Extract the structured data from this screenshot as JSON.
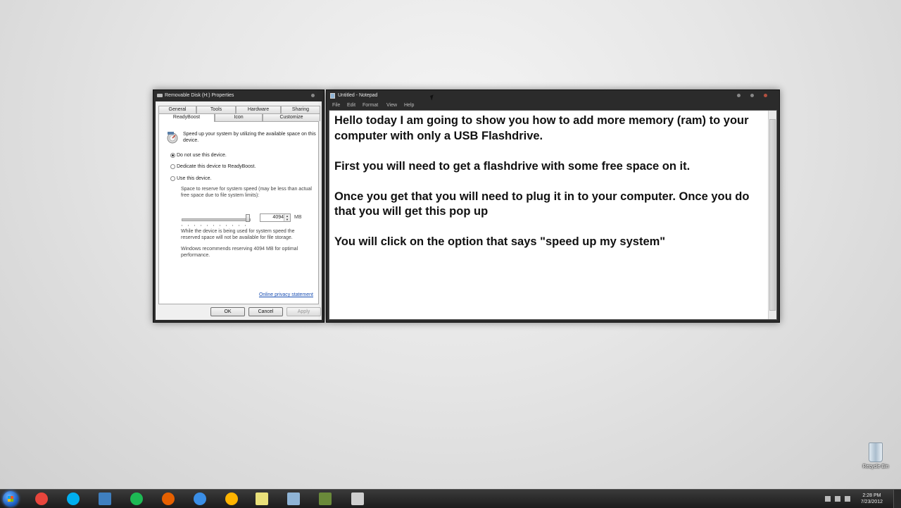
{
  "properties_dialog": {
    "title": "Removable Disk (H:) Properties",
    "tabs_row1": [
      "General",
      "Tools",
      "Hardware",
      "Sharing"
    ],
    "tabs_row2": [
      "ReadyBoost",
      "Icon",
      "Customize"
    ],
    "active_tab": "ReadyBoost",
    "description": "Speed up your system by utilizing the available space on this device.",
    "options": [
      {
        "label": "Do not use this device.",
        "selected": true
      },
      {
        "label": "Dedicate this device to ReadyBoost.",
        "selected": false
      },
      {
        "label": "Use this device.",
        "selected": false
      }
    ],
    "reserve_label": "Space to reserve for system speed (may be less than actual free space due to file system limits):",
    "reserve_value": "4094",
    "reserve_unit": "MB",
    "slider_level": 1.0,
    "storage_note": "While the device is being used for system speed the reserved space will not be available for file storage.",
    "recommend_note": "Windows recommends reserving 4094 MB for optimal performance.",
    "privacy_link": "Online privacy statement",
    "buttons": {
      "ok": "OK",
      "cancel": "Cancel",
      "apply": "Apply"
    }
  },
  "notepad": {
    "title": "Untitled - Notepad",
    "menu": [
      "File",
      "Edit",
      "Format",
      "View",
      "Help"
    ],
    "paragraphs": [
      "Hello today I am going to show you how to add more memory (ram) to your computer with only a USB Flashdrive.",
      "First you will need to get a flashdrive with some free space on it.",
      "Once you get that you will need to plug it in to your computer. Once you do that you will get this pop up",
      "You will click on the option that says \"speed up my system\""
    ]
  },
  "desktop": {
    "recycle_bin_label": "Recycle Bin"
  },
  "taskbar": {
    "apps": [
      {
        "name": "chrome-icon",
        "color": "#e8453c"
      },
      {
        "name": "skype-icon",
        "color": "#00aff0"
      },
      {
        "name": "app-frame-icon",
        "color": "#3f7fbf"
      },
      {
        "name": "spotify-icon",
        "color": "#1db954"
      },
      {
        "name": "firefox-icon",
        "color": "#e66000"
      },
      {
        "name": "itunes-icon",
        "color": "#3a8ee6"
      },
      {
        "name": "aim-icon",
        "color": "#ffb400"
      },
      {
        "name": "sticky-notes-icon",
        "color": "#e9e07a"
      },
      {
        "name": "notepad-icon",
        "color": "#8fb4d6"
      },
      {
        "name": "media-icon",
        "color": "#6a8a3a"
      },
      {
        "name": "removable-disk-icon",
        "color": "#cfcfcf"
      }
    ],
    "time": "2:28 PM",
    "date": "7/23/2012"
  }
}
